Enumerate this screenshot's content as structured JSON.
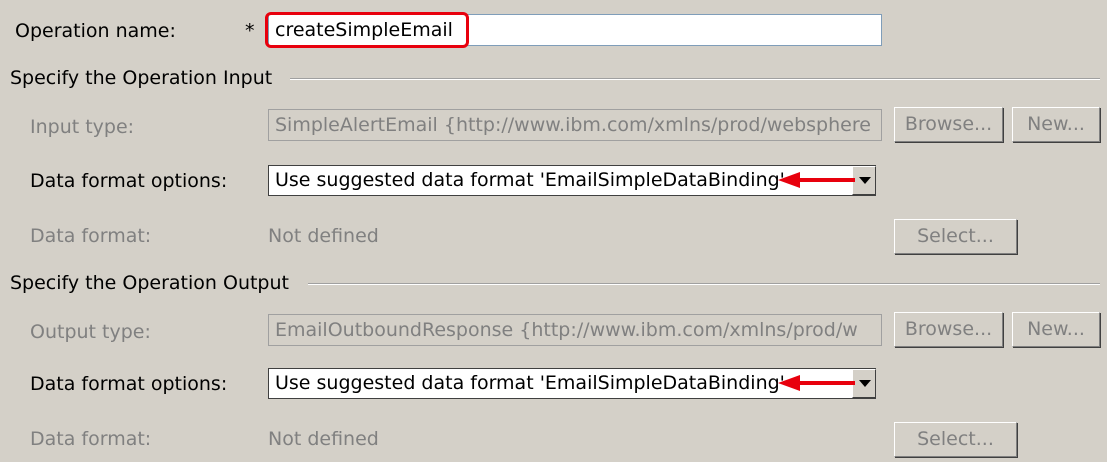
{
  "operation": {
    "label": "Operation name:",
    "required_marker": "*",
    "value": "createSimpleEmail"
  },
  "input_section": {
    "title": "Specify the Operation Input",
    "type_label": "Input type:",
    "type_value": "SimpleAlertEmail  {http://www.ibm.com/xmlns/prod/websphere",
    "browse_label": "Browse...",
    "new_label": "New...",
    "format_options_label": "Data format options:",
    "format_options_value": "Use suggested data format 'EmailSimpleDataBinding'",
    "data_format_label": "Data format:",
    "data_format_value": "Not defined",
    "select_label": "Select..."
  },
  "output_section": {
    "title": "Specify the Operation Output",
    "type_label": "Output type:",
    "type_value": "EmailOutboundResponse  {http://www.ibm.com/xmlns/prod/w",
    "browse_label": "Browse...",
    "new_label": "New...",
    "format_options_label": "Data format options:",
    "format_options_value": "Use suggested data format 'EmailSimpleDataBinding'",
    "data_format_label": "Data format:",
    "data_format_value": "Not defined",
    "select_label": "Select..."
  },
  "colors": {
    "background": "#d4d0c8",
    "highlight_red": "#e8000d",
    "disabled_text": "#808080"
  }
}
